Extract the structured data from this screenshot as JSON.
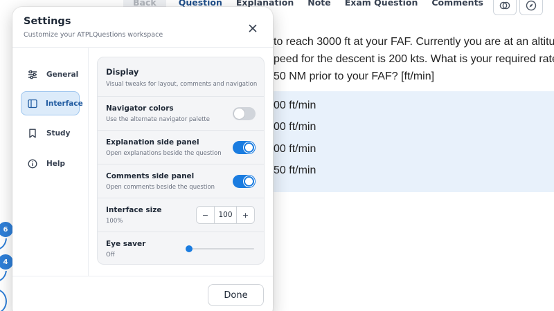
{
  "topnav": {
    "tabs": [
      "Back",
      "Question",
      "Explanation",
      "Note",
      "Exam Question",
      "Comments"
    ],
    "icons": [
      "compare-icon",
      "compass-icon"
    ]
  },
  "question": {
    "lines": [
      "to reach 3000 ft at your FAF. Currently you are at an altitu",
      "peed for the descent is 200 kts. What is your required rate",
      "50 NM prior to your FAF? [ft/min]"
    ]
  },
  "answers": [
    "00 ft/min",
    "00 ft/min",
    "00 ft/min",
    "50 ft/min"
  ],
  "badges": [
    "6",
    "4"
  ],
  "settings": {
    "title": "Settings",
    "subtitle": "Customize your ATPLQuestions workspace",
    "nav": [
      {
        "label": "General",
        "icon": "sliders-icon"
      },
      {
        "label": "Interface",
        "icon": "sidebar-panel-icon"
      },
      {
        "label": "Study",
        "icon": "bookmark-icon"
      },
      {
        "label": "Help",
        "icon": "info-icon"
      }
    ],
    "active_nav": "Interface",
    "section": {
      "title": "Display",
      "desc": "Visual tweaks for layout, comments and navigation"
    },
    "rows": {
      "navigator_colors": {
        "title": "Navigator colors",
        "desc": "Use the alternate navigator palette",
        "on": false
      },
      "explanation_panel": {
        "title": "Explanation side panel",
        "desc": "Open explanations beside the question",
        "on": true
      },
      "comments_panel": {
        "title": "Comments side panel",
        "desc": "Open comments beside the question",
        "on": true
      },
      "interface_size": {
        "title": "Interface size",
        "desc": "100%",
        "value": "100",
        "minus": "−",
        "plus": "+"
      },
      "eye_saver": {
        "title": "Eye saver",
        "desc": "Off",
        "level": 0
      }
    },
    "done_label": "Done"
  },
  "colors": {
    "accent": "#1a7ce0",
    "active_nav_bg": "#dcebfa",
    "answer_bg": "#e8f1fb"
  }
}
